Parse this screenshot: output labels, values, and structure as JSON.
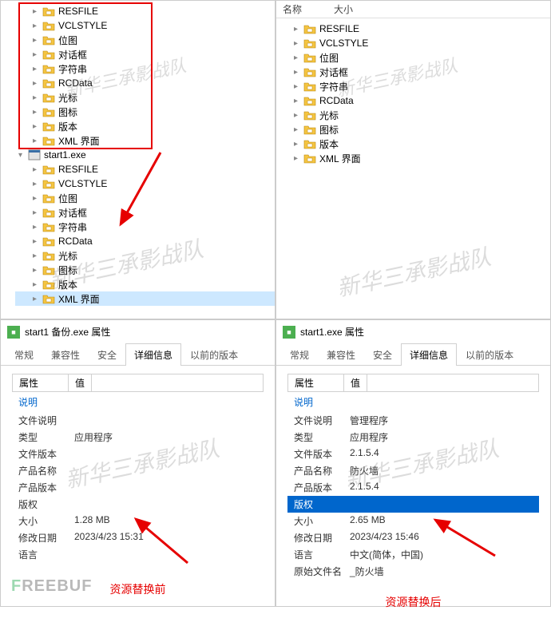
{
  "watermark": "新华三承影战队",
  "top_header": {
    "name": "名称",
    "size": "大小"
  },
  "tree_left": {
    "box": [
      "RESFILE",
      "VCLSTYLE",
      "位图",
      "对话框",
      "字符串",
      "RCData",
      "光标",
      "图标",
      "版本",
      "XML 界面"
    ],
    "exe": "start1.exe",
    "below": [
      "RESFILE",
      "VCLSTYLE",
      "位图",
      "对话框",
      "字符串",
      "RCData",
      "光标",
      "图标",
      "版本",
      "XML 界面"
    ]
  },
  "tree_right": [
    "RESFILE",
    "VCLSTYLE",
    "位图",
    "对话框",
    "字符串",
    "RCData",
    "光标",
    "图标",
    "版本",
    "XML 界面"
  ],
  "props_left": {
    "title": "start1 备份.exe 属性",
    "tabs": [
      "常规",
      "兼容性",
      "安全",
      "详细信息",
      "以前的版本"
    ],
    "active_tab": 3,
    "headers": {
      "property": "属性",
      "value": "值"
    },
    "link": "说明",
    "rows": [
      {
        "k": "文件说明",
        "v": ""
      },
      {
        "k": "类型",
        "v": "应用程序"
      },
      {
        "k": "文件版本",
        "v": ""
      },
      {
        "k": "产品名称",
        "v": ""
      },
      {
        "k": "产品版本",
        "v": ""
      },
      {
        "k": "版权",
        "v": ""
      },
      {
        "k": "大小",
        "v": "1.28 MB"
      },
      {
        "k": "修改日期",
        "v": "2023/4/23 15:31"
      },
      {
        "k": "语言",
        "v": ""
      }
    ],
    "caption": "资源替换前"
  },
  "props_right": {
    "title": "start1.exe 属性",
    "tabs": [
      "常规",
      "兼容性",
      "安全",
      "详细信息",
      "以前的版本"
    ],
    "active_tab": 3,
    "headers": {
      "property": "属性",
      "value": "值"
    },
    "link": "说明",
    "rows": [
      {
        "k": "文件说明",
        "v": "管理程序"
      },
      {
        "k": "类型",
        "v": "应用程序"
      },
      {
        "k": "文件版本",
        "v": "2.1.5.4"
      },
      {
        "k": "产品名称",
        "v": "防火墙"
      },
      {
        "k": "产品版本",
        "v": "2.1.5.4"
      },
      {
        "k": "版权",
        "v": "",
        "selected": true
      },
      {
        "k": "大小",
        "v": "2.65 MB"
      },
      {
        "k": "修改日期",
        "v": "2023/4/23 15:46"
      },
      {
        "k": "语言",
        "v": "中文(简体，中国)"
      },
      {
        "k": "原始文件名",
        "v": "_防火墙"
      }
    ],
    "caption": "资源替换后"
  },
  "logo": {
    "t1": "F",
    "t2": "REEBUF"
  }
}
